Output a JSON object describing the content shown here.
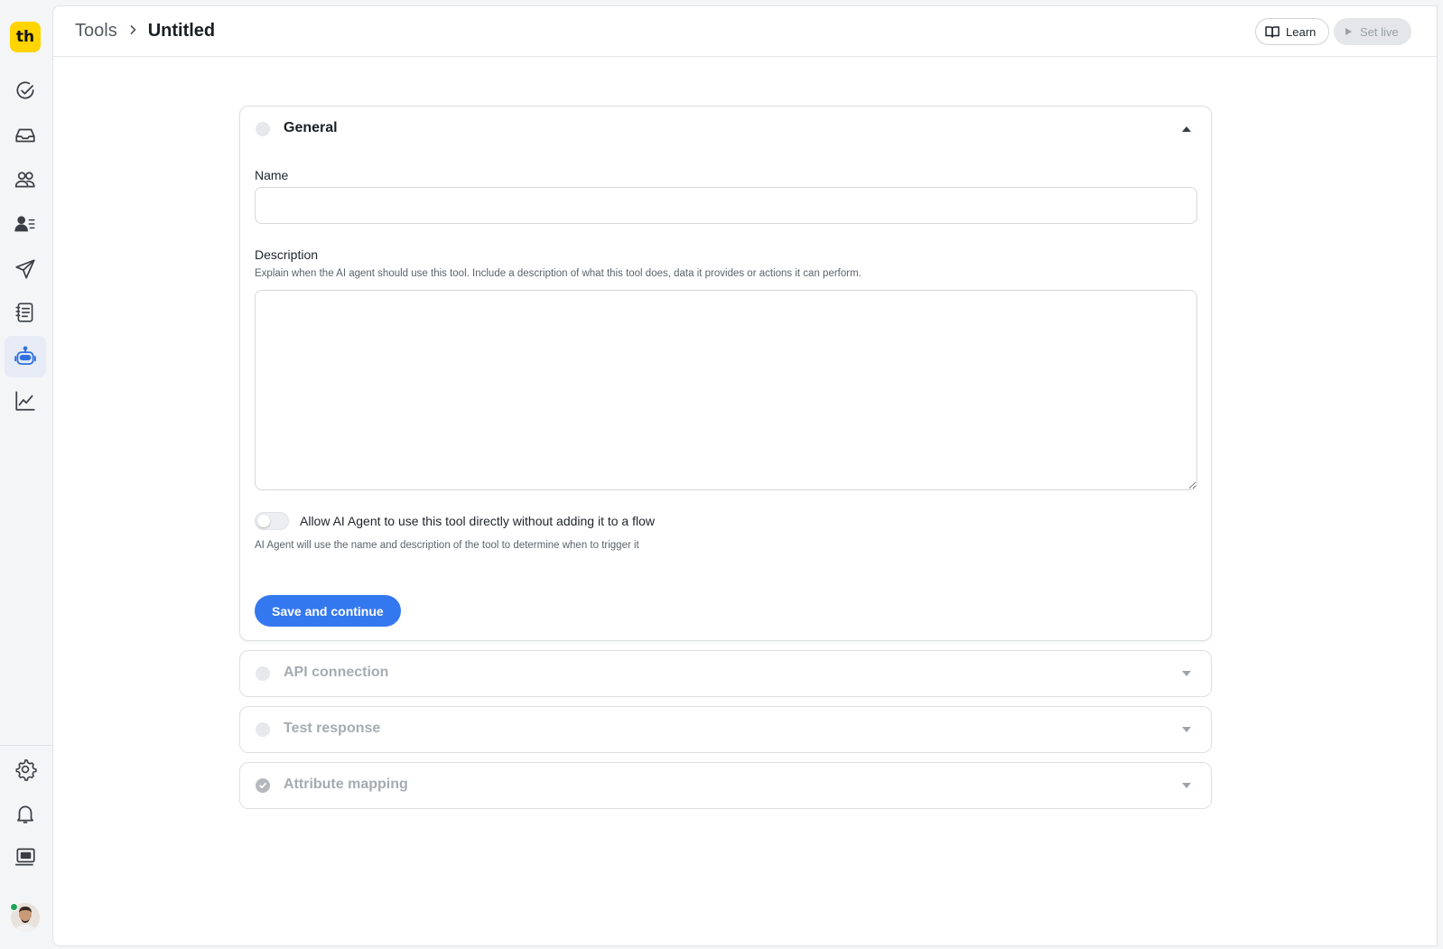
{
  "app": {
    "logo_text": "th",
    "brand_color": "#ffd400",
    "accent_color": "#3478f0"
  },
  "sidebar": {
    "items": [
      {
        "name": "tasks",
        "icon": "check-circle-icon"
      },
      {
        "name": "inbox",
        "icon": "inbox-icon"
      },
      {
        "name": "contacts",
        "icon": "users-icon"
      },
      {
        "name": "contact-list",
        "icon": "user-list-icon"
      },
      {
        "name": "broadcasts",
        "icon": "send-icon"
      },
      {
        "name": "reports-list",
        "icon": "notebook-icon"
      },
      {
        "name": "ai-agent",
        "icon": "bot-icon",
        "active": true
      },
      {
        "name": "analytics",
        "icon": "line-chart-icon"
      }
    ],
    "bottom_items": [
      {
        "name": "settings",
        "icon": "gear-icon"
      },
      {
        "name": "notifications",
        "icon": "bell-icon"
      },
      {
        "name": "billing",
        "icon": "billing-icon"
      }
    ]
  },
  "header": {
    "breadcrumb_root": "Tools",
    "breadcrumb_current": "Untitled",
    "learn_label": "Learn",
    "set_live_label": "Set live"
  },
  "general": {
    "title": "General",
    "name_label": "Name",
    "name_value": "",
    "description_label": "Description",
    "description_hint": "Explain when the AI agent should use this tool. Include a description of what this tool does, data it provides or actions it can perform.",
    "description_value": "",
    "toggle_label": "Allow AI Agent to use this tool directly without adding it to a flow",
    "toggle_on": false,
    "toggle_hint": "AI Agent will use the name and description of the tool to determine when to trigger it",
    "save_label": "Save and continue"
  },
  "sections": {
    "api_connection": "API connection",
    "test_response": "Test response",
    "attribute_mapping": "Attribute mapping"
  }
}
